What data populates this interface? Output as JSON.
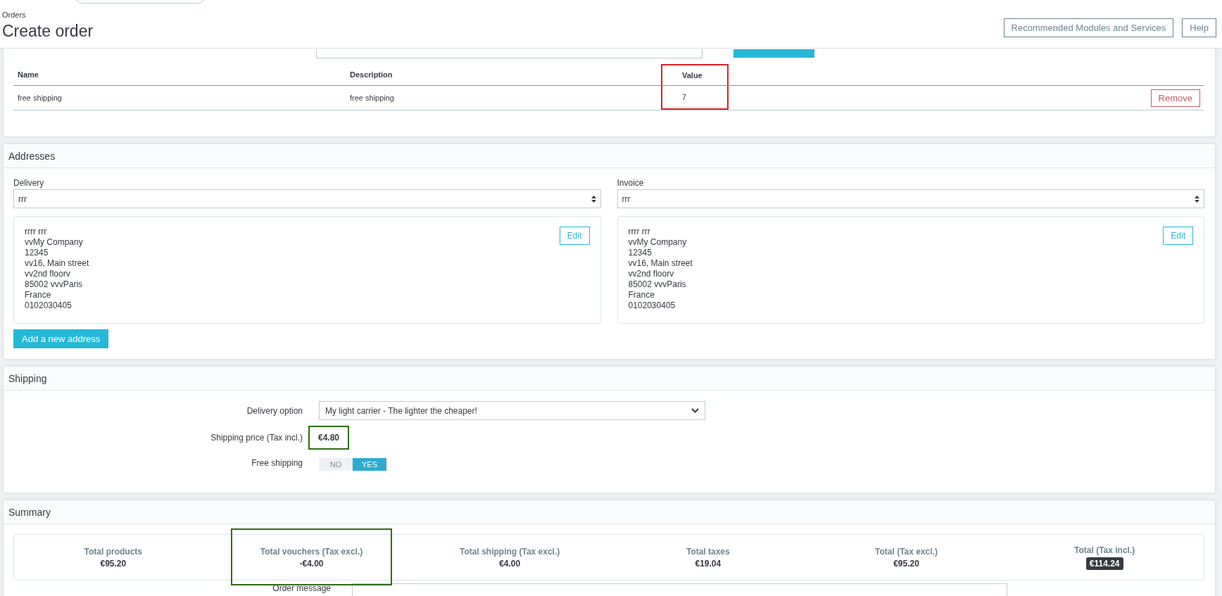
{
  "header": {
    "breadcrumb": "Orders",
    "title": "Create order",
    "buttons": [
      "Recommended Modules and Services",
      "Help"
    ]
  },
  "vouchers": {
    "columns": [
      {
        "label": "Name"
      },
      {
        "label": "Description"
      },
      {
        "label": "Value",
        "color": "#e02020"
      }
    ],
    "rows": [
      {
        "cells": [
          "free shipping",
          "free shipping",
          "7"
        ],
        "action": "Remove"
      }
    ]
  },
  "addresses": {
    "title": "Addresses",
    "blocks": [
      {
        "label": "Delivery",
        "selected_value": "rrr",
        "lines": [
          "rrrr rrr",
          "vvMy Company",
          "12345",
          "vv16, Main street",
          "vv2nd floorv",
          "85002 vvvParis",
          "France",
          "0102030405"
        ],
        "edit": "Edit"
      },
      {
        "label": "Invoice",
        "selected_value": "rrr",
        "lines": [
          "rrrr rrr",
          "vvMy Company",
          "12345",
          "vv16, Main street",
          "vv2nd floorv",
          "85002 vvvParis",
          "France",
          "0102030405"
        ],
        "edit": "Edit"
      }
    ],
    "add_button": "Add a new address"
  },
  "shipping": {
    "title": "Shipping",
    "delivery_label": "Delivery option",
    "delivery_value": "My light carrier - The lighter the cheaper!",
    "price_label": "Shipping price (Tax incl.)",
    "price": {
      "text": "€4.80",
      "color": "#2e6e12"
    },
    "free_label": "Free shipping",
    "free_options": [
      {
        "label": "NO",
        "selected": false
      },
      {
        "label": "YES",
        "selected": true
      }
    ]
  },
  "summary": {
    "title": "Summary",
    "totals": [
      {
        "label": "Total products",
        "value": "€95.20",
        "kind": "plain"
      },
      {
        "label": "Total vouchers (Tax excl.)",
        "value": "-€4.00",
        "kind": "plain",
        "color": "#2e6e12"
      },
      {
        "label": "Total shipping (Tax excl.)",
        "value": "€4.00",
        "kind": "plain"
      },
      {
        "label": "Total taxes",
        "value": "€19.04",
        "kind": "plain"
      },
      {
        "label": "Total (Tax excl.)",
        "value": "€95.20",
        "kind": "plain"
      },
      {
        "label": "Total (Tax incl.)",
        "value": "€114.24",
        "kind": "badge"
      }
    ],
    "message_label": "Order message"
  }
}
